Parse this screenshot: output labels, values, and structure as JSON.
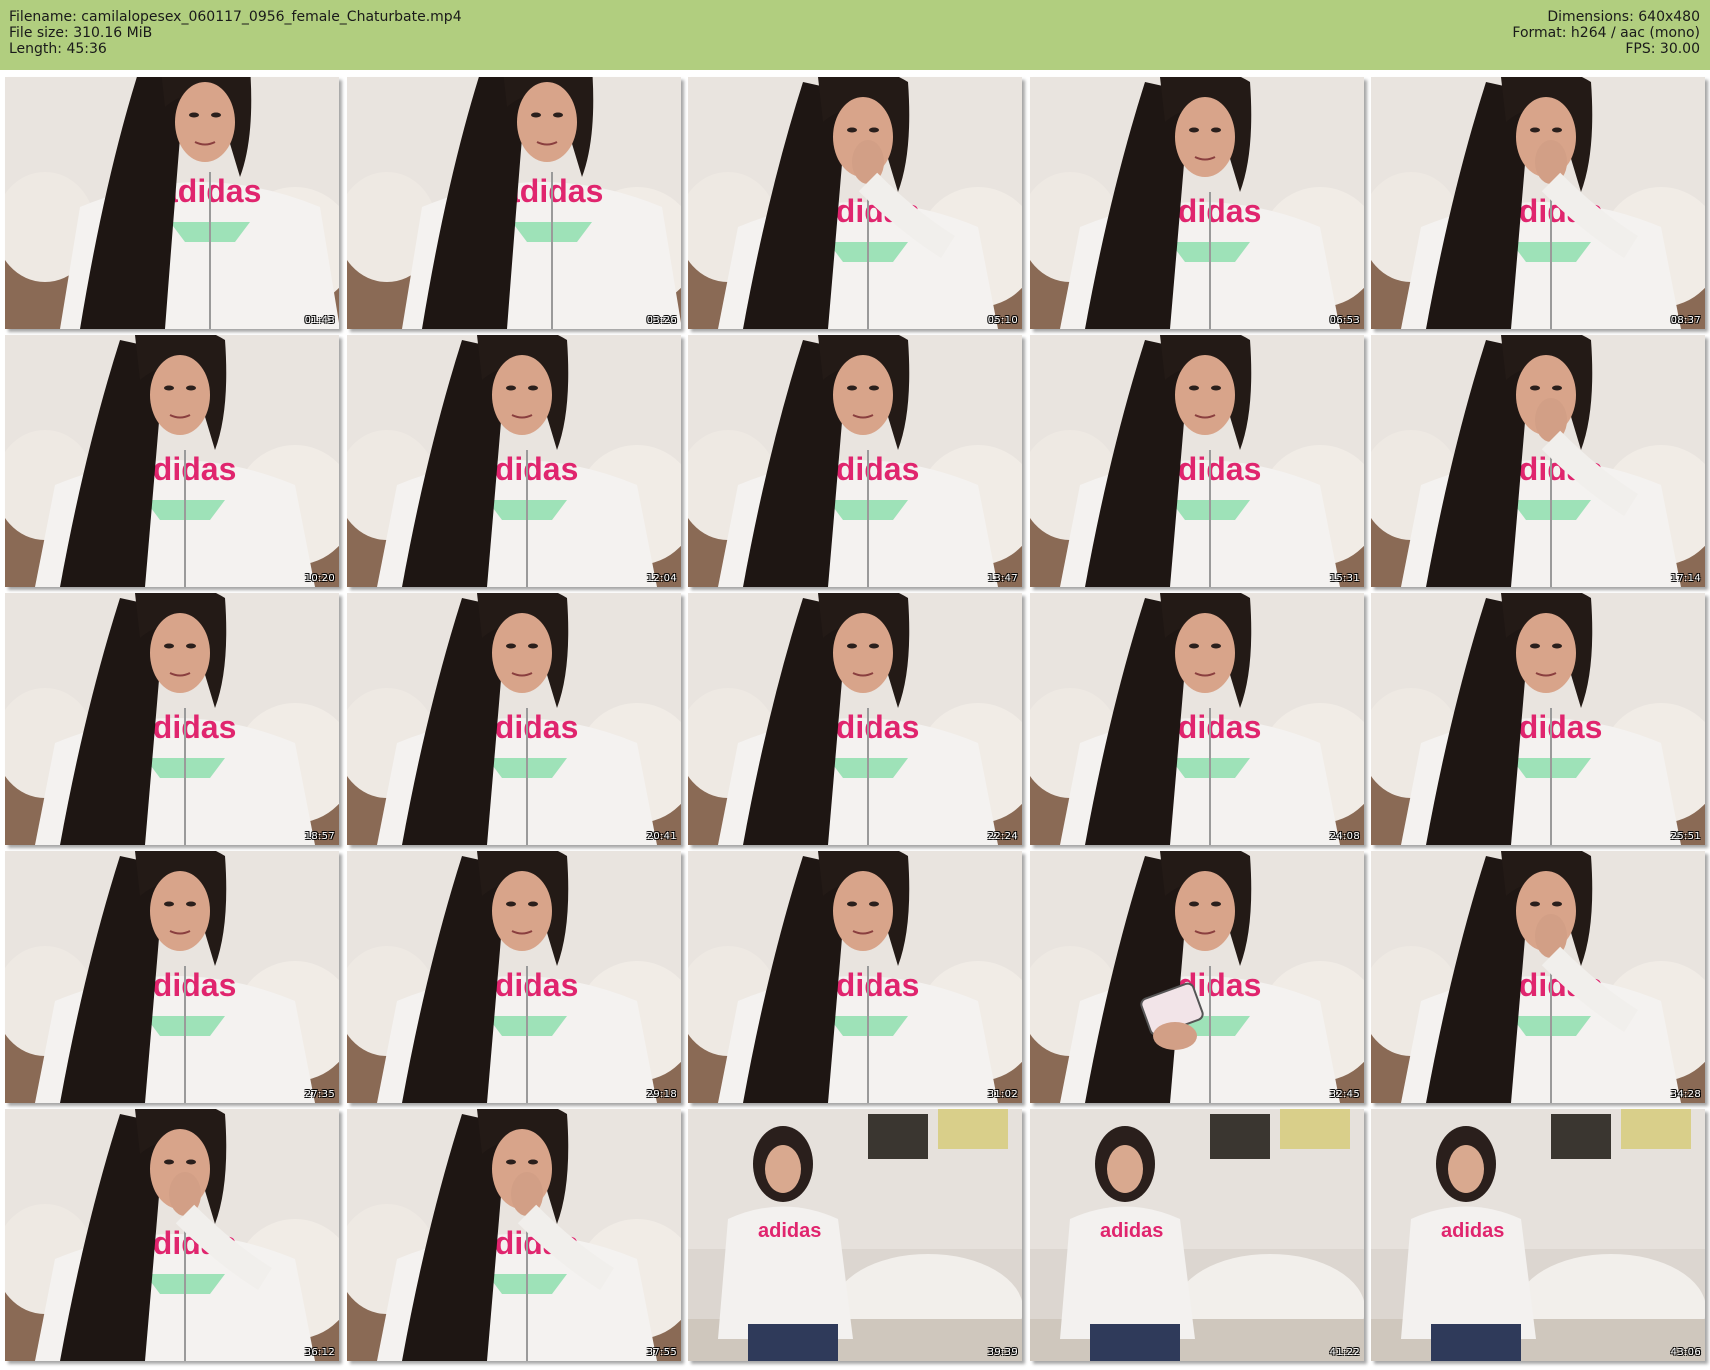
{
  "header": {
    "filename": "Filename: camilalopesex_060117_0956_female_Chaturbate.mp4",
    "filesize": "File size: 310.16 MiB",
    "length": "Length: 45:36",
    "dimensions": "Dimensions: 640x480",
    "format": "Format: h264 / aac (mono)",
    "fps": "FPS: 30.00"
  },
  "colors": {
    "header_bg": "#b1ce7f",
    "hoodie_text": "#e0256e",
    "hoodie_logo": "#9ee2b8"
  },
  "thumbnails": [
    {
      "timestamp": "01:43",
      "scene": "lean"
    },
    {
      "timestamp": "03:26",
      "scene": "lean"
    },
    {
      "timestamp": "05:10",
      "scene": "hand"
    },
    {
      "timestamp": "06:53",
      "scene": "sit"
    },
    {
      "timestamp": "08:37",
      "scene": "hand"
    },
    {
      "timestamp": "10:20",
      "scene": "sit"
    },
    {
      "timestamp": "12:04",
      "scene": "sit"
    },
    {
      "timestamp": "13:47",
      "scene": "sit"
    },
    {
      "timestamp": "15:31",
      "scene": "sit"
    },
    {
      "timestamp": "17:14",
      "scene": "hand"
    },
    {
      "timestamp": "18:57",
      "scene": "sit"
    },
    {
      "timestamp": "20:41",
      "scene": "sit"
    },
    {
      "timestamp": "22:24",
      "scene": "sit"
    },
    {
      "timestamp": "24:08",
      "scene": "sit"
    },
    {
      "timestamp": "25:51",
      "scene": "sit"
    },
    {
      "timestamp": "27:35",
      "scene": "sit"
    },
    {
      "timestamp": "29:18",
      "scene": "sit"
    },
    {
      "timestamp": "31:02",
      "scene": "sit"
    },
    {
      "timestamp": "32:45",
      "scene": "phone"
    },
    {
      "timestamp": "34:28",
      "scene": "hand"
    },
    {
      "timestamp": "36:12",
      "scene": "hand"
    },
    {
      "timestamp": "37:55",
      "scene": "hand"
    },
    {
      "timestamp": "39:39",
      "scene": "far"
    },
    {
      "timestamp": "41:22",
      "scene": "far"
    },
    {
      "timestamp": "43:06",
      "scene": "far"
    }
  ]
}
